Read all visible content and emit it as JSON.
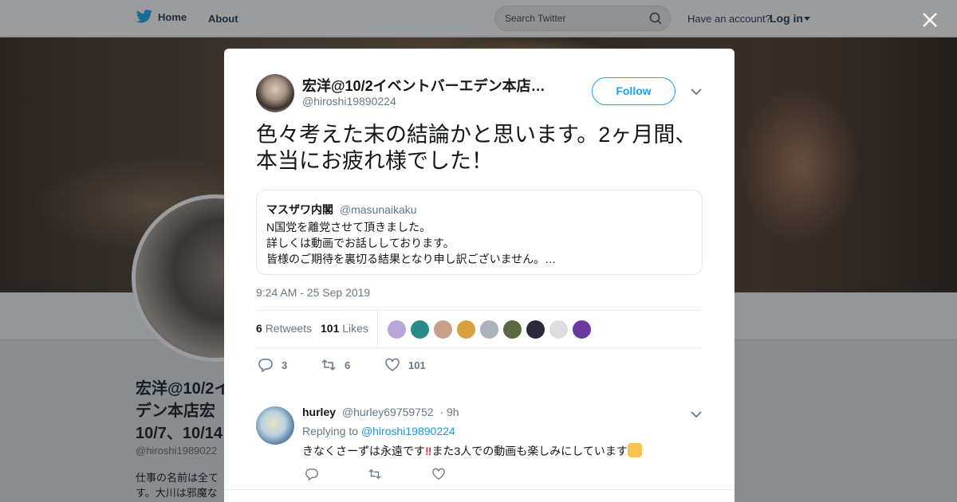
{
  "nav": {
    "home_label": "Home",
    "about_label": "About",
    "search_placeholder": "Search Twitter",
    "have_account": "Have an account?",
    "login_label": "Log in"
  },
  "background_profile": {
    "name_lines": "宏洋@10/2イ デン本店宏 10/7、10/14",
    "handle": "@hiroshi1989022",
    "bio": "仕事の名前は全て す。大川は邪魔な"
  },
  "tweet": {
    "author_name": "宏洋@10/2イベントバーエデン本店…",
    "author_handle": "@hiroshi19890224",
    "follow_label": "Follow",
    "text": "色々考えた末の結論かと思います。2ヶ月間、本当にお疲れ様でした！",
    "quote": {
      "name": "マスザワ内閣",
      "handle": "@masunaikaku",
      "lines": [
        "N国党を離党させて頂きました。",
        "詳しくは動画でお話ししております。",
        "皆様のご期待を裏切る結果となり申し訳ございません。…"
      ]
    },
    "timestamp": "9:24 AM - 25 Sep 2019",
    "retweets_count": "6",
    "retweets_label": "Retweets",
    "likes_count": "101",
    "likes_label": "Likes",
    "liker_colors": [
      "#b9a6d9",
      "#2a8a8a",
      "#c9a08a",
      "#d9a040",
      "#aab3bb",
      "#5a6a40",
      "#2a2a3a",
      "#dddddd",
      "#6a3aa0"
    ],
    "actions": {
      "reply_count": "3",
      "retweet_count": "6",
      "like_count": "101"
    }
  },
  "reply": {
    "name": "hurley",
    "handle": "@hurley69759752",
    "time": "· 9h",
    "replying_prefix": "Replying to",
    "replying_to": "@hiroshi19890224",
    "text_before": "きなくさーずは永遠です",
    "bang": "‼",
    "text_after": "また3人での動画も楽しみにしています"
  },
  "colors": {
    "accent": "#1da1f2",
    "text_primary": "#14171a",
    "text_secondary": "#657786",
    "overlay": "#8a8d90"
  }
}
